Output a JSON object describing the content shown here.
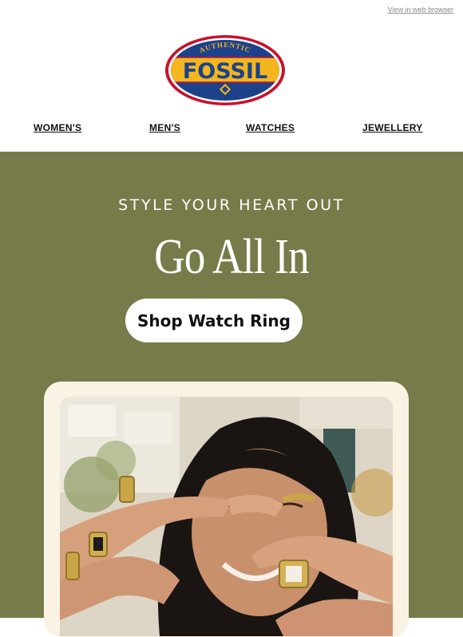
{
  "header": {
    "view_in_browser": "View in web browser",
    "logo": {
      "top_text": "AUTHENTIC",
      "brand": "FOSSIL",
      "colors": {
        "outer_red": "#c8102e",
        "inner_blue": "#1d428a",
        "band_yellow": "#f3b61f"
      }
    }
  },
  "nav": {
    "items": [
      {
        "label": "WOMEN'S"
      },
      {
        "label": "MEN'S"
      },
      {
        "label": "WATCHES"
      },
      {
        "label": "JEWELLERY"
      }
    ]
  },
  "hero": {
    "background_color": "#777b49",
    "eyebrow": "STYLE YOUR HEART OUT",
    "headline": "Go All In",
    "cta_label": "Shop Watch Ring",
    "card_color": "#faf3e4"
  }
}
